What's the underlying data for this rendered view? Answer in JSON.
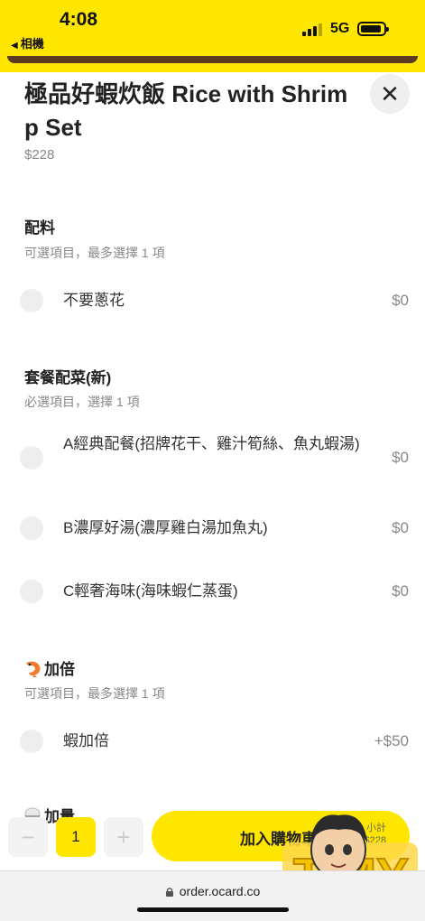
{
  "status_bar": {
    "time": "4:08",
    "back_label": "相機",
    "network": "5G"
  },
  "product": {
    "title": "極品好蝦炊飯 Rice with Shrimp Set",
    "price": "$228"
  },
  "sections": [
    {
      "title": "配料",
      "subtitle": "可選項目，最多選擇 1 項",
      "options": [
        {
          "label": "不要蔥花",
          "price": "$0"
        }
      ]
    },
    {
      "title": "套餐配菜(新)",
      "subtitle": "必選項目，選擇 1 項",
      "options": [
        {
          "label": "A經典配餐(招牌花干、雞汁筍絲、魚丸蝦湯)",
          "price": "$0"
        },
        {
          "label": "B濃厚好湯(濃厚雞白湯加魚丸)",
          "price": "$0"
        },
        {
          "label": "C輕奢海味(海味蝦仁蒸蛋)",
          "price": "$0"
        }
      ]
    },
    {
      "title": "加倍",
      "icon": "shrimp-icon",
      "subtitle": "可選項目，最多選擇 1 項",
      "options": [
        {
          "label": "蝦加倍",
          "price": "+$50"
        }
      ]
    },
    {
      "title": "加量",
      "icon": "rice-bowl-icon"
    }
  ],
  "bottom_bar": {
    "quantity": "1",
    "minus": "−",
    "plus": "+",
    "add_to_cart": "加入購物車",
    "subtotal_label": "小計",
    "subtotal_value": "$228"
  },
  "browser": {
    "url": "order.ocard.co"
  },
  "colors": {
    "accent": "#ffe600",
    "radio": "#eeeeee",
    "muted_text": "#888888"
  }
}
